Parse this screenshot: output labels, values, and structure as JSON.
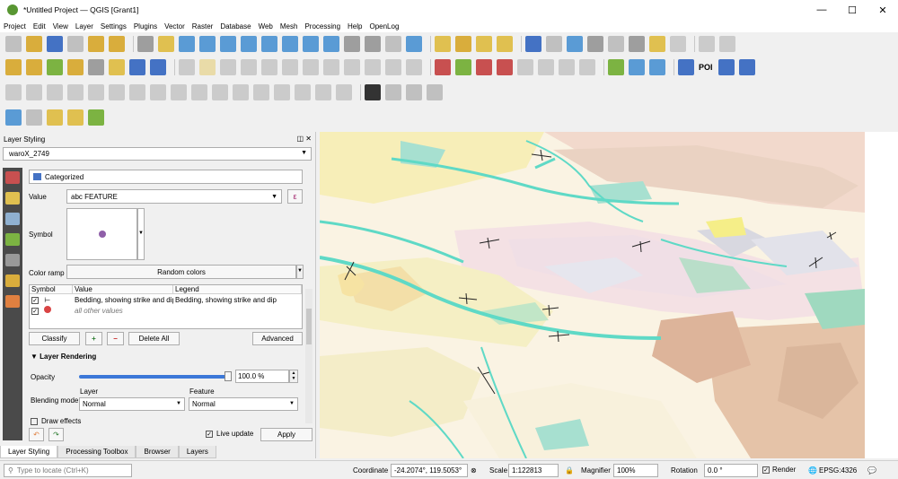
{
  "window": {
    "title": "*Untitled Project — QGIS [Grant1]",
    "minimize": "—",
    "maximize": "☐",
    "close": "✕"
  },
  "menu": [
    "Project",
    "Edit",
    "View",
    "Layer",
    "Settings",
    "Plugins",
    "Vector",
    "Raster",
    "Database",
    "Web",
    "Mesh",
    "Processing",
    "Help",
    "OpenLog"
  ],
  "toolbar2": {
    "poi_label": "POI"
  },
  "panel": {
    "title": "Layer Styling",
    "controls": "◫ ✕",
    "layer": "waroX_2749",
    "renderer": "Categorized",
    "value_label": "Value",
    "value_field": "abc FEATURE",
    "expr_icon": "ε",
    "symbol_label": "Symbol",
    "color_ramp_label": "Color ramp",
    "color_ramp": "Random colors",
    "table": {
      "headers": [
        "Symbol",
        "Value",
        "Legend"
      ],
      "rows": [
        {
          "value": "Bedding, showing strike and dip",
          "legend": "Bedding, showing strike and dip"
        },
        {
          "value": "all other values",
          "legend": ""
        }
      ]
    },
    "buttons": {
      "classify": "Classify",
      "add": "+",
      "remove": "−",
      "delete_all": "Delete All",
      "advanced": "Advanced"
    },
    "layer_rendering": {
      "header": "Layer Rendering",
      "opacity_label": "Opacity",
      "opacity_value": "100.0 %",
      "opacity_fraction": 1.0,
      "blending_label": "Blending mode",
      "layer_label": "Layer",
      "layer_mode": "Normal",
      "feature_label": "Feature",
      "feature_mode": "Normal",
      "draw_effects": "Draw effects"
    },
    "live_update": "Live update",
    "apply": "Apply"
  },
  "bottom_tabs": [
    "Layer Styling",
    "Processing Toolbox",
    "Browser",
    "Layers"
  ],
  "status": {
    "locate_placeholder": "Type to locate (Ctrl+K)",
    "coordinate_label": "Coordinate",
    "coordinate": "-24.2074°, 119.5053°",
    "scale_label": "Scale",
    "scale": "1:122813",
    "magnifier_label": "Magnifier",
    "magnifier": "100%",
    "rotation_label": "Rotation",
    "rotation": "0.0 °",
    "render_label": "Render",
    "crs": "EPSG:4326"
  }
}
